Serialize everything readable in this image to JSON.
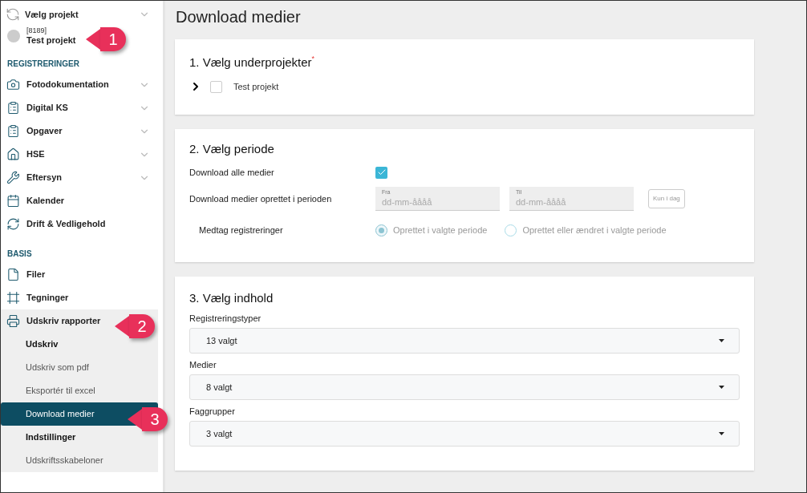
{
  "sidebar": {
    "project_picker": {
      "label": "Vælg projekt",
      "expanded": false
    },
    "project": {
      "number": "[8189]",
      "name": "Test projekt"
    },
    "sections": [
      {
        "heading": "REGISTRERINGER",
        "items": [
          {
            "label": "Fotodokumentation",
            "expandable": true,
            "expanded": false
          },
          {
            "label": "Digital KS",
            "expandable": true,
            "expanded": false
          },
          {
            "label": "Opgaver",
            "expandable": true,
            "expanded": false
          },
          {
            "label": "HSE",
            "expandable": true,
            "expanded": false
          },
          {
            "label": "Eftersyn",
            "expandable": true,
            "expanded": false
          },
          {
            "label": "Kalender",
            "expanded": false
          },
          {
            "label": "Drift & Vedligehold",
            "expanded": false
          }
        ]
      },
      {
        "heading": "BASIS",
        "items": [
          {
            "label": "Filer",
            "expanded": false
          },
          {
            "label": "Tegninger",
            "expanded": false
          },
          {
            "label": "Udskriv rapporter",
            "expanded": true,
            "children": [
              {
                "kind": "heading",
                "label": "Udskriv",
                "selected": false
              },
              {
                "kind": "link",
                "label": "Udskriv som pdf",
                "selected": false
              },
              {
                "kind": "link",
                "label": "Eksportér til excel",
                "selected": false
              },
              {
                "kind": "link",
                "label": "Download medier",
                "selected": true
              },
              {
                "kind": "heading",
                "label": "Indstillinger",
                "selected": false
              },
              {
                "kind": "link",
                "label": "Udskriftsskabeloner",
                "selected": false
              }
            ]
          }
        ]
      }
    ]
  },
  "page_title": "Download medier",
  "step1": {
    "title": "1. Vælg underprojekter",
    "required_mark": "*",
    "tree": [
      {
        "label": "Test projekt",
        "expanded": false,
        "checked": false
      }
    ]
  },
  "step2": {
    "title": "2. Vælg periode",
    "all_media": {
      "label": "Download alle medier",
      "checked": true
    },
    "period": {
      "label": "Download medier oprettet i perioden",
      "disabled": true,
      "fields": [
        {
          "label": "Fra",
          "placeholder": "dd-mm-åååå"
        },
        {
          "label": "Til",
          "placeholder": "dd-mm-åååå"
        }
      ],
      "today_button": "Kun i dag"
    },
    "include": {
      "label": "Medtag registreringer",
      "disabled": true,
      "options": [
        {
          "label": "Oprettet i valgte periode",
          "selected": true
        },
        {
          "label": "Oprettet eller ændret i valgte periode",
          "selected": false
        }
      ]
    }
  },
  "step3": {
    "title": "3. Vælg indhold",
    "selects": [
      {
        "label": "Registreringstyper",
        "value": "13 valgt"
      },
      {
        "label": "Medier",
        "value": "8 valgt"
      },
      {
        "label": "Faggrupper",
        "value": "3 valgt"
      }
    ]
  },
  "callouts": [
    {
      "number": "1"
    },
    {
      "number": "2"
    },
    {
      "number": "3"
    }
  ]
}
